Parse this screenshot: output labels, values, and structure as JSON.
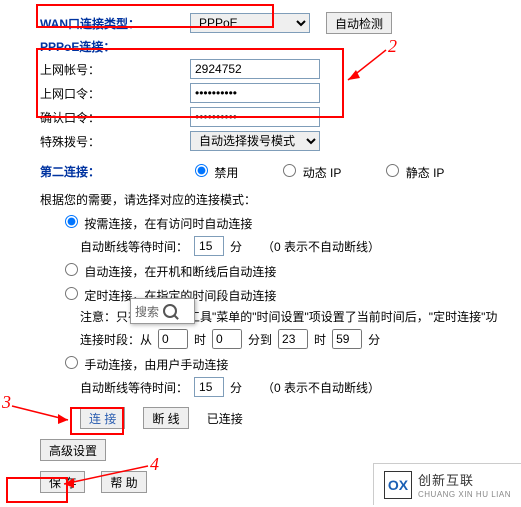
{
  "wan_type": {
    "label": "WAN口连接类型：",
    "value": "PPPoE",
    "detect_btn": "自动检测"
  },
  "pppoe_title": "PPPoE连接：",
  "account": {
    "label": "上网帐号：",
    "value": "2924752"
  },
  "password": {
    "label": "上网口令：",
    "value": "●●●●●●●●●●"
  },
  "confirm": {
    "label": "确认口令：",
    "value": "●●●●●●●●●●"
  },
  "special_dial": {
    "label": "特殊拨号：",
    "value": "自动选择拨号模式"
  },
  "second_conn": {
    "label": "第二连接：",
    "opts": [
      "禁用",
      "动态 IP",
      "静态 IP"
    ]
  },
  "mode_prompt": "根据您的需要，请选择对应的连接模式：",
  "mode": {
    "on_demand": "按需连接，在有访问时自动连接",
    "auto_dc_wait": "自动断线等待时间：",
    "auto_dc_value": "15",
    "auto_dc_unit": "分",
    "auto_dc_hint": "（0 表示不自动断线）",
    "auto": "自动连接，在开机和断线后自动连接",
    "scheduled": "定时连接，在指定的时间段自动连接",
    "note_prefix": "注意：只有",
    "note_suffix": "统工具\"菜单的\"时间设置\"项设置了当前时间后，\"定时连接\"功",
    "search_placeholder": "搜索",
    "time_range": "连接时段：从",
    "t1": "0",
    "t2": "0",
    "t3": "23",
    "t4": "59",
    "u_hour": "时",
    "u_min": "分",
    "u_to": "分到",
    "manual": "手动连接，由用户手动连接",
    "btn_connect": "连 接",
    "btn_disconnect": "断 线",
    "status_connected": "已连接"
  },
  "advanced": "高级设置",
  "save": "保 存",
  "help": "帮 助",
  "annotations": {
    "n2": "2",
    "n3": "3",
    "n4": "4"
  },
  "brand": {
    "mark": "OX",
    "name": "创新互联",
    "sub": "CHUANG XIN HU LIAN"
  }
}
